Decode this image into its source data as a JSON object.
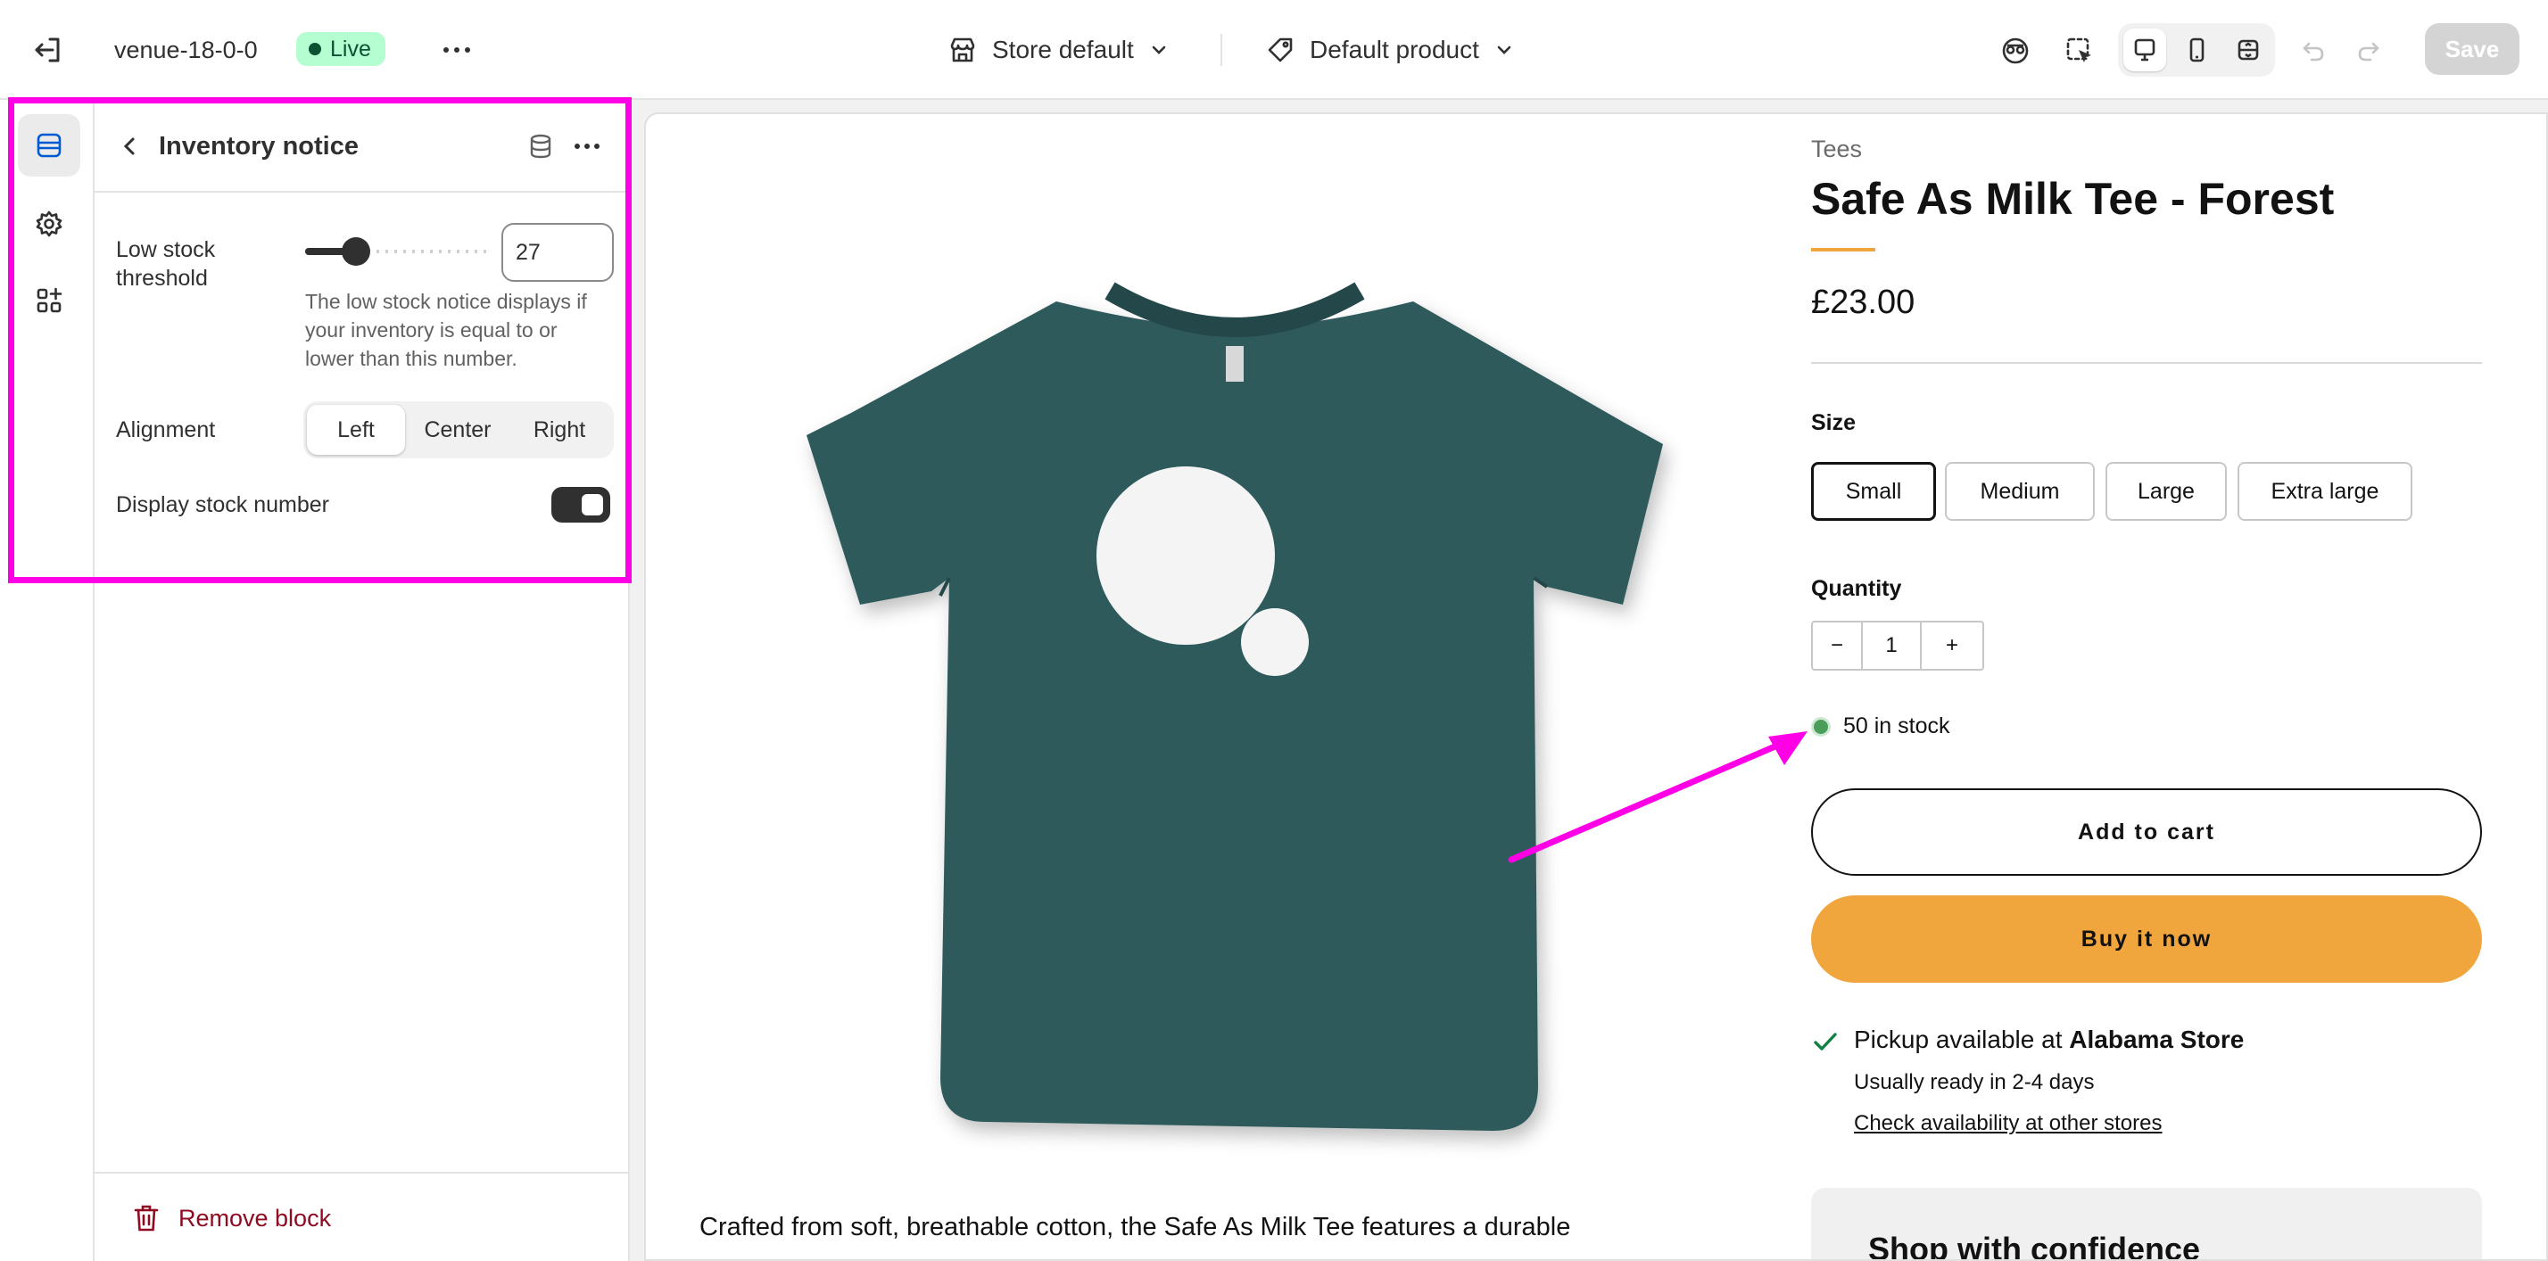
{
  "topbar": {
    "theme_name": "venue-18-0-0",
    "live_label": "Live",
    "store_selector": "Store default",
    "product_selector": "Default product",
    "save_label": "Save"
  },
  "rail": {
    "items": [
      "sections-icon",
      "settings-gear-icon",
      "apps-icon"
    ]
  },
  "panel": {
    "title": "Inventory notice",
    "threshold": {
      "label": "Low stock threshold",
      "value": "27",
      "slider_fraction": 0.27,
      "help": "The low stock notice displays if your inventory is equal to or lower than this number."
    },
    "alignment": {
      "label": "Alignment",
      "options": [
        "Left",
        "Center",
        "Right"
      ],
      "selected": "Left"
    },
    "display_stock": {
      "label": "Display stock number",
      "enabled": true
    },
    "remove_label": "Remove block"
  },
  "product": {
    "vendor": "Tees",
    "title": "Safe As Milk Tee - Forest",
    "price": "£23.00",
    "size_label": "Size",
    "sizes": [
      "Small",
      "Medium",
      "Large",
      "Extra large"
    ],
    "selected_size": "Small",
    "quantity_label": "Quantity",
    "quantity": "1",
    "qty_minus": "−",
    "qty_plus": "+",
    "stock_text": "50 in stock",
    "add_to_cart": "Add to cart",
    "buy_now": "Buy it now",
    "pickup": {
      "prefix": "Pickup available at ",
      "store": "Alabama Store",
      "ready": "Usually ready in 2-4 days",
      "link": "Check availability at other stores"
    },
    "confidence_heading": "Shop with confidence",
    "description": "Crafted from soft, breathable cotton, the Safe As Milk Tee features a durable"
  },
  "colors": {
    "shirt": "#2f5a5c",
    "accent": "#f0a63c",
    "highlight": "#ff00e6",
    "live_badge": "#b4fed2",
    "remove": "#8e0b21"
  }
}
